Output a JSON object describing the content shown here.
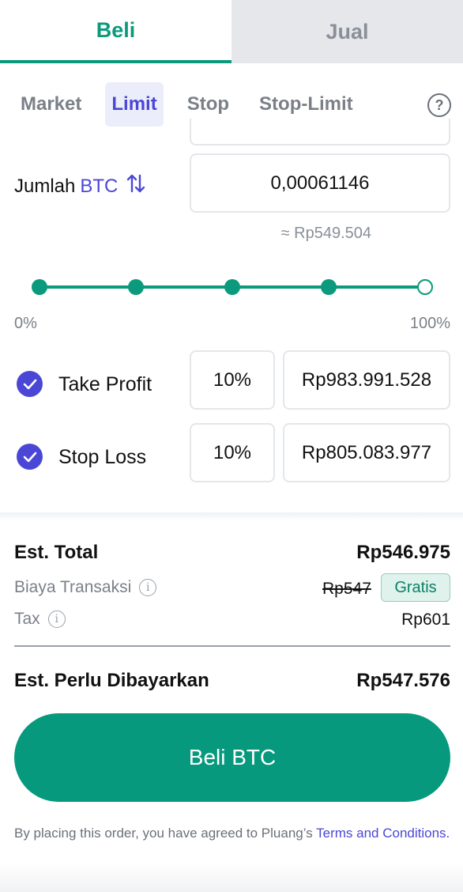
{
  "tabs": {
    "buy": "Beli",
    "sell": "Jual"
  },
  "order_types": [
    "Market",
    "Limit",
    "Stop",
    "Stop-Limit"
  ],
  "selected_order_type": "Limit",
  "help_icon": "?",
  "amount": {
    "label": "Jumlah",
    "asset": "BTC",
    "value": "0,00061146",
    "approx": "≈ Rp549.504"
  },
  "slider": {
    "min_label": "0%",
    "max_label": "100%",
    "level_percent": 100
  },
  "take_profit": {
    "label": "Take Profit",
    "percent": "10%",
    "price": "Rp983.991.528",
    "checked": true
  },
  "stop_loss": {
    "label": "Stop Loss",
    "percent": "10%",
    "price": "Rp805.083.977",
    "checked": true
  },
  "summary": {
    "est_total_label": "Est. Total",
    "est_total_value": "Rp546.975",
    "fee_label": "Biaya Transaksi",
    "fee_original": "Rp547",
    "fee_badge": "Gratis",
    "tax_label": "Tax",
    "tax_value": "Rp601",
    "payable_label": "Est. Perlu Dibayarkan",
    "payable_value": "Rp547.576"
  },
  "buy_button": "Beli BTC",
  "terms": {
    "prefix": "By placing this order, you have agreed to Pluang’s",
    "link": "Terms and Conditions."
  },
  "colors": {
    "brand_green": "#07997d",
    "accent_purple": "#4a47d6",
    "badge_bg": "#dff3ec"
  }
}
